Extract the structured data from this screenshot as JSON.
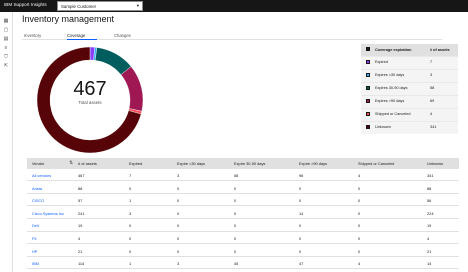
{
  "header": {
    "brand": "IBM Support Insights",
    "customer_select": "Sample Customer"
  },
  "sidenav": {
    "icons": [
      "dashboard-icon",
      "inventory-icon",
      "document-icon",
      "list-icon",
      "filter-icon",
      "export-icon"
    ]
  },
  "page": {
    "title": "Inventory management"
  },
  "tabs": [
    {
      "label": "Inventory",
      "active": false
    },
    {
      "label": "Coverage",
      "active": true
    },
    {
      "label": "Changes",
      "active": false
    }
  ],
  "chart_data": {
    "type": "pie",
    "center_value": "467",
    "center_label": "Total assets",
    "slices": [
      {
        "label": "Expired",
        "value": 7,
        "color": "#8a3ffc"
      },
      {
        "label": "Expires <30 days",
        "value": 3,
        "color": "#33b1ff"
      },
      {
        "label": "Expires 30-90 days",
        "value": 58,
        "color": "#005d5d"
      },
      {
        "label": "Expires >90 days",
        "value": 69,
        "color": "#9f1853"
      },
      {
        "label": "Shipped or Canceled",
        "value": 4,
        "color": "#fa4d56"
      },
      {
        "label": "Unknown",
        "value": 341,
        "color": "#570408"
      }
    ]
  },
  "legend": {
    "header_label": "Coverage expiration",
    "header_count": "# of assets",
    "rows": [
      {
        "label": "Expired",
        "count": "7"
      },
      {
        "label": "Expires <30 days",
        "count": "3"
      },
      {
        "label": "Expires 30-90 days",
        "count": "58"
      },
      {
        "label": "Expires >90 days",
        "count": "69"
      },
      {
        "label": "Shipped or Canceled",
        "count": "4"
      },
      {
        "label": "Unknown",
        "count": "341"
      }
    ]
  },
  "table": {
    "headers": [
      "Vendor",
      "# of assets",
      "Expired",
      "Expire <30 days",
      "Expire 30-90 days",
      "Expire >90 days",
      "Shipped or Canceled",
      "Unknown"
    ],
    "rows": [
      [
        "All vendors",
        "467",
        "7",
        "3",
        "58",
        "96",
        "4",
        "341"
      ],
      [
        "Arista",
        "88",
        "0",
        "0",
        "0",
        "0",
        "0",
        "88"
      ],
      [
        "CISCO",
        "57",
        "1",
        "0",
        "0",
        "0",
        "0",
        "56"
      ],
      [
        "Cisco Systems Inc",
        "241",
        "3",
        "0",
        "0",
        "14",
        "0",
        "224"
      ],
      [
        "Dell",
        "19",
        "0",
        "0",
        "0",
        "0",
        "0",
        "19"
      ],
      [
        "F5",
        "4",
        "0",
        "0",
        "0",
        "0",
        "0",
        "4"
      ],
      [
        "HP",
        "21",
        "0",
        "0",
        "0",
        "0",
        "0",
        "21"
      ],
      [
        "IBM",
        "114",
        "1",
        "3",
        "45",
        "47",
        "4",
        "14"
      ]
    ]
  }
}
